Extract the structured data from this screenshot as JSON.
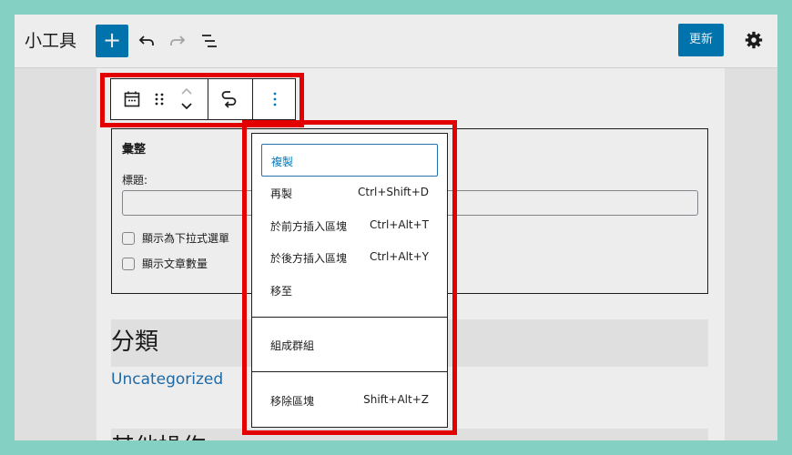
{
  "header": {
    "title": "小工具",
    "add_label": "+",
    "update_label": "更新"
  },
  "widget": {
    "title": "彙整",
    "field_label": "標題:",
    "title_value": "",
    "options": [
      {
        "label": "顯示為下拉式選單",
        "checked": false
      },
      {
        "label": "顯示文章數量",
        "checked": false
      }
    ]
  },
  "sections": {
    "categories_heading": "分類",
    "category_link": "Uncategorized",
    "more_heading": "其他操作"
  },
  "menu": {
    "group1": [
      {
        "label": "複製",
        "shortcut": ""
      },
      {
        "label": "再製",
        "shortcut": "Ctrl+Shift+D"
      },
      {
        "label": "於前方插入區塊",
        "shortcut": "Ctrl+Alt+T"
      },
      {
        "label": "於後方插入區塊",
        "shortcut": "Ctrl+Alt+Y"
      },
      {
        "label": "移至",
        "shortcut": ""
      }
    ],
    "group2": [
      {
        "label": "組成群組",
        "shortcut": ""
      }
    ],
    "group3": [
      {
        "label": "移除區塊",
        "shortcut": "Shift+Alt+Z"
      }
    ]
  },
  "colors": {
    "accent": "#007cba",
    "highlight": "#e20000",
    "background": "#8ee0d2"
  }
}
